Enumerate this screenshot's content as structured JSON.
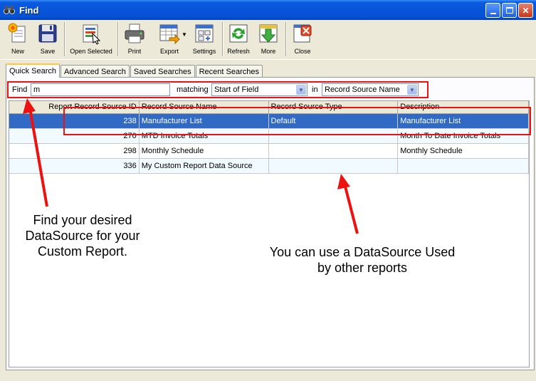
{
  "window": {
    "title": "Find"
  },
  "toolbar": {
    "new": "New",
    "save": "Save",
    "open_selected": "Open Selected",
    "print": "Print",
    "export": "Export",
    "settings": "Settings",
    "refresh": "Refresh",
    "more": "More",
    "close": "Close"
  },
  "tabs": [
    "Quick Search",
    "Advanced Search",
    "Saved Searches",
    "Recent Searches"
  ],
  "find": {
    "label": "Find",
    "value": "m",
    "matching_label": "matching",
    "matching_value": "Start of Field",
    "in_label": "in",
    "in_value": "Record Source Name"
  },
  "grid": {
    "columns": [
      "Report Record Source ID",
      "Record Source Name",
      "Record Source Type",
      "Description"
    ],
    "rows": [
      [
        "238",
        "Manufacturer List",
        "Default",
        "Manufacturer List"
      ],
      [
        "270",
        "MTD Invoice Totals",
        "",
        "Month To Date Invoice Totals"
      ],
      [
        "298",
        "Monthly Schedule",
        "",
        "Monthly Schedule"
      ],
      [
        "336",
        "My Custom Report Data Source",
        "",
        ""
      ]
    ]
  },
  "annotations": {
    "left": "Find your desired DataSource for your Custom Report.",
    "right": "You can use a DataSource Used by other reports"
  },
  "colors": {
    "annotation_red": "#EE1111",
    "selection_blue": "#316AC5",
    "titlebar_blue": "#0754D8"
  }
}
